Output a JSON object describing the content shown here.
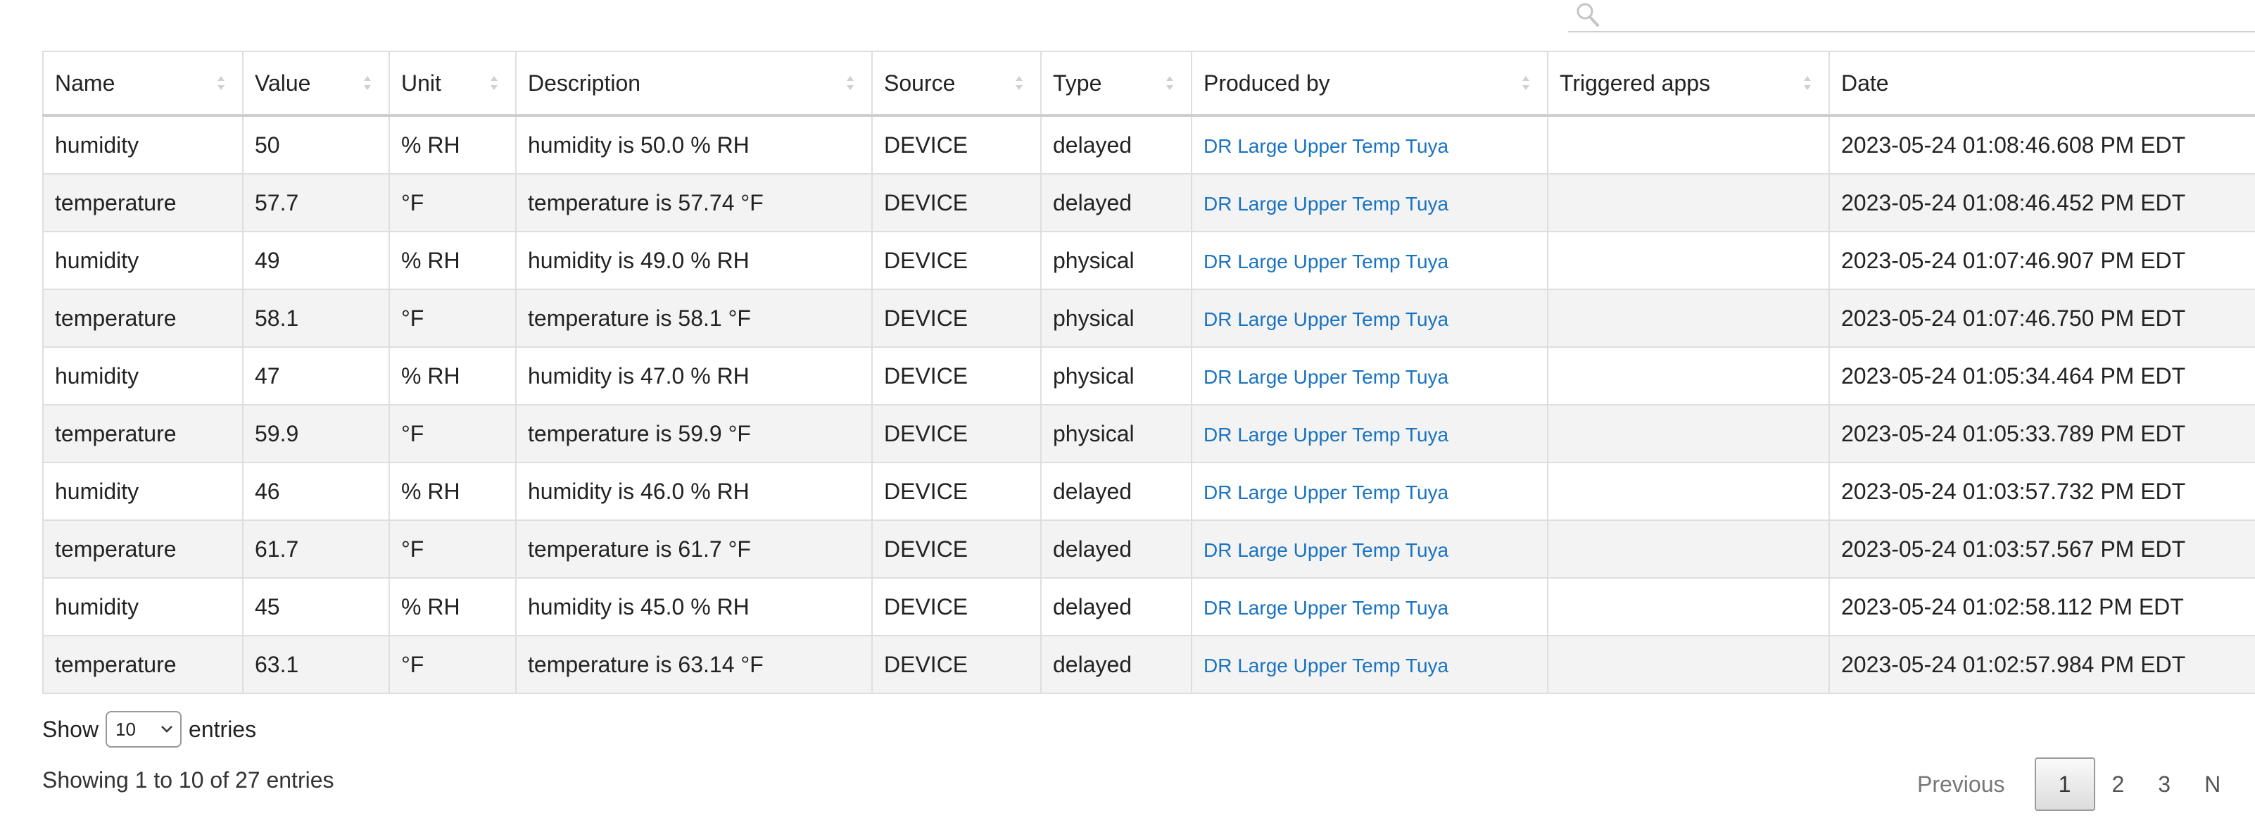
{
  "search": {
    "placeholder": "",
    "value": "",
    "icon": "search-icon"
  },
  "table": {
    "columns": [
      "Name",
      "Value",
      "Unit",
      "Description",
      "Source",
      "Type",
      "Produced by",
      "Triggered apps",
      "Date"
    ],
    "rows": [
      {
        "name": "humidity",
        "value": "50",
        "unit": "% RH",
        "description": "humidity is 50.0 % RH",
        "source": "DEVICE",
        "type": "delayed",
        "produced_by": "DR Large Upper Temp Tuya",
        "triggered_apps": "",
        "date": "2023-05-24 01:08:46.608 PM EDT"
      },
      {
        "name": "temperature",
        "value": "57.7",
        "unit": "°F",
        "description": "temperature is 57.74 °F",
        "source": "DEVICE",
        "type": "delayed",
        "produced_by": "DR Large Upper Temp Tuya",
        "triggered_apps": "",
        "date": "2023-05-24 01:08:46.452 PM EDT"
      },
      {
        "name": "humidity",
        "value": "49",
        "unit": "% RH",
        "description": "humidity is 49.0 % RH",
        "source": "DEVICE",
        "type": "physical",
        "produced_by": "DR Large Upper Temp Tuya",
        "triggered_apps": "",
        "date": "2023-05-24 01:07:46.907 PM EDT"
      },
      {
        "name": "temperature",
        "value": "58.1",
        "unit": "°F",
        "description": "temperature is 58.1 °F",
        "source": "DEVICE",
        "type": "physical",
        "produced_by": "DR Large Upper Temp Tuya",
        "triggered_apps": "",
        "date": "2023-05-24 01:07:46.750 PM EDT"
      },
      {
        "name": "humidity",
        "value": "47",
        "unit": "% RH",
        "description": "humidity is 47.0 % RH",
        "source": "DEVICE",
        "type": "physical",
        "produced_by": "DR Large Upper Temp Tuya",
        "triggered_apps": "",
        "date": "2023-05-24 01:05:34.464 PM EDT"
      },
      {
        "name": "temperature",
        "value": "59.9",
        "unit": "°F",
        "description": "temperature is 59.9 °F",
        "source": "DEVICE",
        "type": "physical",
        "produced_by": "DR Large Upper Temp Tuya",
        "triggered_apps": "",
        "date": "2023-05-24 01:05:33.789 PM EDT"
      },
      {
        "name": "humidity",
        "value": "46",
        "unit": "% RH",
        "description": "humidity is 46.0 % RH",
        "source": "DEVICE",
        "type": "delayed",
        "produced_by": "DR Large Upper Temp Tuya",
        "triggered_apps": "",
        "date": "2023-05-24 01:03:57.732 PM EDT"
      },
      {
        "name": "temperature",
        "value": "61.7",
        "unit": "°F",
        "description": "temperature is 61.7 °F",
        "source": "DEVICE",
        "type": "delayed",
        "produced_by": "DR Large Upper Temp Tuya",
        "triggered_apps": "",
        "date": "2023-05-24 01:03:57.567 PM EDT"
      },
      {
        "name": "humidity",
        "value": "45",
        "unit": "% RH",
        "description": "humidity is 45.0 % RH",
        "source": "DEVICE",
        "type": "delayed",
        "produced_by": "DR Large Upper Temp Tuya",
        "triggered_apps": "",
        "date": "2023-05-24 01:02:58.112 PM EDT"
      },
      {
        "name": "temperature",
        "value": "63.1",
        "unit": "°F",
        "description": "temperature is 63.14 °F",
        "source": "DEVICE",
        "type": "delayed",
        "produced_by": "DR Large Upper Temp Tuya",
        "triggered_apps": "",
        "date": "2023-05-24 01:02:57.984 PM EDT"
      }
    ]
  },
  "length": {
    "show_label": "Show",
    "selected": "10",
    "entries_label": "entries"
  },
  "info": "Showing 1 to 10 of 27 entries",
  "pagination": {
    "previous": "Previous",
    "pages": [
      "1",
      "2",
      "3"
    ],
    "current": "1",
    "next": "N"
  },
  "colors": {
    "link": "#1a73c0",
    "row_alt": "#f3f3f3",
    "border": "#dedede"
  }
}
